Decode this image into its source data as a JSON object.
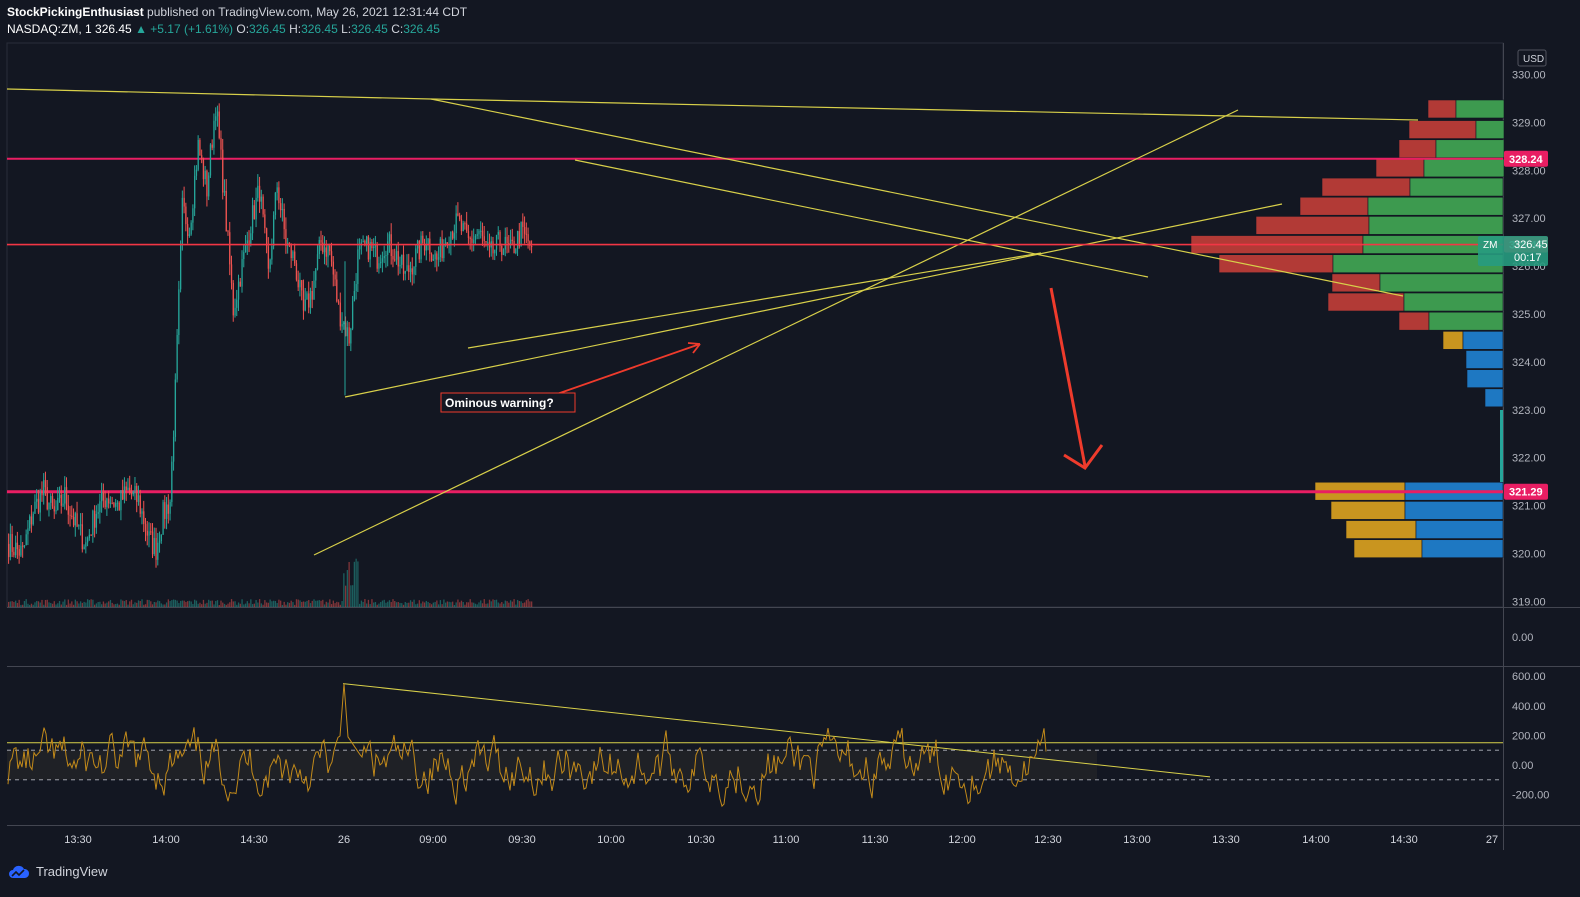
{
  "header": {
    "author": "StockPickingEnthusiast",
    "published_text": "published on TradingView.com, May 26, 2021 12:31:44 CDT",
    "symbol": "NASDAQ:ZM, 1",
    "last": "326.45",
    "change": "▲ +5.17 (+1.61%)",
    "o_label": "O:",
    "o": "326.45",
    "h_label": "H:",
    "h": "326.45",
    "l_label": "L:",
    "l": "326.45",
    "c_label": "C:",
    "c": "326.45"
  },
  "footer": {
    "brand": "TradingView"
  },
  "colors": {
    "background": "#131722",
    "up": "#26a69a",
    "down": "#ef5350",
    "trendline": "#d8d04a",
    "resistance": "#e91e63",
    "price_line": "#f23645",
    "annotation": "#ef3b2c",
    "oscillator": "#c28a1a"
  },
  "chart_data": [
    {
      "type": "candlestick",
      "symbol": "NASDAQ:ZM",
      "interval": "1",
      "currency": "USD",
      "ylim": [
        318.9,
        330.6
      ],
      "y_ticks": [
        "330.00",
        "329.00",
        "328.00",
        "327.00",
        "326.00",
        "325.00",
        "324.00",
        "323.00",
        "322.00",
        "321.00",
        "320.00",
        "319.00"
      ],
      "x_ticks": [
        "13:30",
        "14:00",
        "14:30",
        "26",
        "09:00",
        "09:30",
        "10:00",
        "10:30",
        "11:00",
        "11:30",
        "12:00",
        "12:30",
        "13:00",
        "13:30",
        "14:00",
        "14:30",
        "27"
      ],
      "price_labels": [
        {
          "value": "328.24",
          "color": "#e91e63"
        },
        {
          "value": "326.45",
          "color": "#f23645"
        },
        {
          "value": "321.29",
          "color": "#e91e63"
        }
      ],
      "last_tag": {
        "symbol": "ZM",
        "price": "326.45",
        "countdown": "00:17"
      },
      "horizontal_levels": [
        328.24,
        326.45,
        321.29
      ],
      "annotation": "Ominous warning?",
      "close_path": [
        [
          0,
          320.2
        ],
        [
          8,
          320.0
        ],
        [
          14,
          320.9
        ],
        [
          20,
          321.3
        ],
        [
          26,
          320.8
        ],
        [
          32,
          321.2
        ],
        [
          38,
          320.6
        ],
        [
          44,
          320.2
        ],
        [
          50,
          320.9
        ],
        [
          56,
          321.2
        ],
        [
          62,
          321.0
        ],
        [
          68,
          321.3
        ],
        [
          74,
          321.1
        ],
        [
          80,
          320.3
        ],
        [
          84,
          320.1
        ],
        [
          88,
          320.8
        ],
        [
          92,
          321.1
        ],
        [
          95,
          323.4
        ],
        [
          99,
          327.2
        ],
        [
          103,
          326.8
        ],
        [
          108,
          328.5
        ],
        [
          113,
          327.6
        ],
        [
          118,
          329.4
        ],
        [
          122,
          327.8
        ],
        [
          128,
          325.1
        ],
        [
          133,
          326.0
        ],
        [
          138,
          326.9
        ],
        [
          143,
          327.6
        ],
        [
          148,
          325.8
        ],
        [
          153,
          327.7
        ],
        [
          158,
          326.5
        ],
        [
          163,
          326.1
        ],
        [
          168,
          325.0
        ],
        [
          173,
          325.5
        ],
        [
          178,
          326.5
        ],
        [
          183,
          326.3
        ],
        [
          188,
          325.1
        ],
        [
          194,
          324.5
        ],
        [
          199,
          326.2
        ],
        [
          205,
          326.4
        ],
        [
          210,
          326.2
        ],
        [
          215,
          326.5
        ],
        [
          220,
          326.3
        ],
        [
          226,
          325.8
        ],
        [
          232,
          326.2
        ],
        [
          238,
          326.6
        ],
        [
          244,
          326.1
        ],
        [
          250,
          326.7
        ],
        [
          256,
          326.9
        ],
        [
          262,
          326.5
        ],
        [
          268,
          326.7
        ],
        [
          274,
          326.2
        ],
        [
          280,
          326.5
        ],
        [
          286,
          326.3
        ],
        [
          292,
          326.7
        ],
        [
          298,
          326.4
        ]
      ],
      "oscillator": {
        "y_ticks": [
          "600.00",
          "400.00",
          "200.00",
          "0.00",
          "-200.00"
        ],
        "ylim": [
          -420,
          680
        ],
        "levels": [
          100,
          -100
        ],
        "upper_line": 150,
        "spike": 550
      },
      "middle_pane": {
        "y_ticks": [
          "0.00"
        ]
      }
    }
  ]
}
